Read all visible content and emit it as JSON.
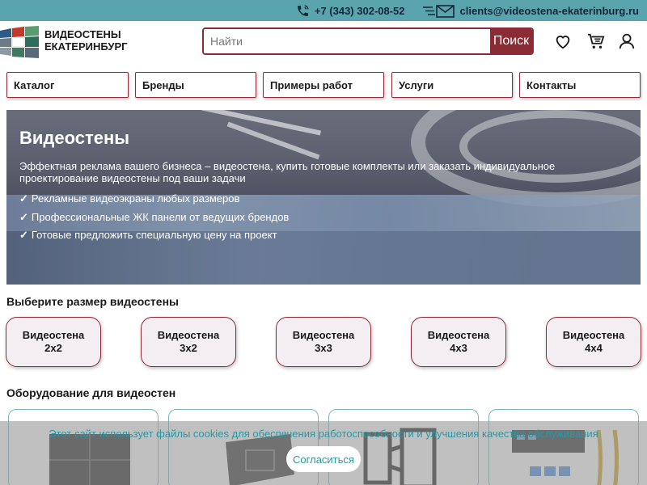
{
  "topbar": {
    "phone": "+7 (343) 302-08-52",
    "email": "clients@videostena-ekaterinburg.ru",
    "phone_icon": "phone-icon",
    "email_icon": "mail-icon"
  },
  "header": {
    "brand_line1": "ВИДЕОСТЕНЫ",
    "brand_line2": "ЕКАТЕРИНБУРГ",
    "search_placeholder": "Найти",
    "search_button": "Поиск",
    "icons": [
      "heart-icon",
      "cart-icon",
      "user-icon"
    ]
  },
  "nav": {
    "items": [
      "Каталог",
      "Бренды",
      "Примеры работ",
      "Услуги",
      "Контакты"
    ]
  },
  "hero": {
    "title": "Видеостены",
    "description": "Эффектная реклама вашего бизнеса – видеостена, купить готовые комплекты или заказать индивидуальное проектирование видеостены под ваши задачи",
    "check_mark": "✓",
    "bullets": [
      "Рекламные видеоэкраны любых размеров",
      "Профессиональные ЖК панели от ведущих брендов",
      "Готовые предложить специальную цену на проект"
    ]
  },
  "sizes": {
    "title": "Выберите размер видеостены",
    "items": [
      {
        "line1": "Видеостена",
        "line2": "2x2"
      },
      {
        "line1": "Видеостена",
        "line2": "3x2"
      },
      {
        "line1": "Видеостена",
        "line2": "3x3"
      },
      {
        "line1": "Видеостена",
        "line2": "4x3"
      },
      {
        "line1": "Видеостена",
        "line2": "4x4"
      }
    ]
  },
  "equipment": {
    "title": "Оборудование для видеостен"
  },
  "cookie": {
    "message": "Этот сайт использует файлы cookies для обеспечения работоспособности и улучшения качества обслуживания",
    "accept": "Согласиться"
  },
  "colors": {
    "topbar": "#5aa5ad",
    "accent": "#8b2b35",
    "cookie_text": "#2c96a2"
  }
}
